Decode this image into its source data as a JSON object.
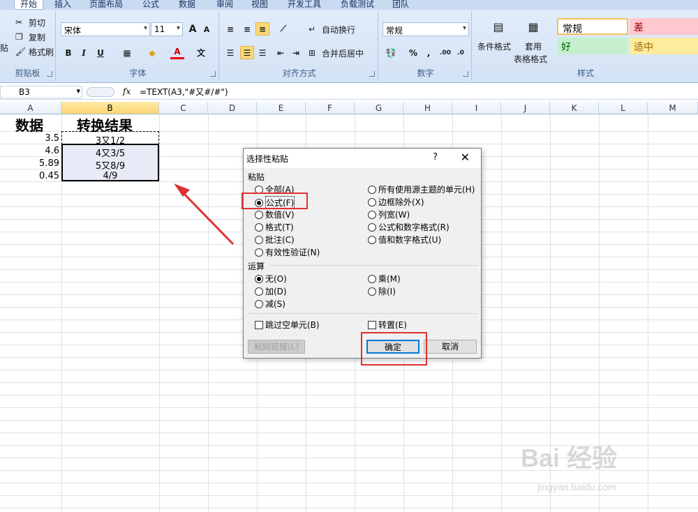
{
  "ribbon": {
    "tabs": [
      "开始",
      "插入",
      "页面布局",
      "公式",
      "数据",
      "审阅",
      "视图",
      "开发工具",
      "负载测试",
      "团队"
    ],
    "clipboard": {
      "cut": "剪切",
      "copy": "复制",
      "painter": "格式刷",
      "paste_partial": "贴",
      "label": "剪贴板"
    },
    "font": {
      "name": "宋体",
      "size": "11",
      "label": "字体",
      "bold": "B",
      "italic": "I",
      "underline": "U",
      "grow": "A",
      "shrink": "A",
      "color_letter": "A",
      "phonetic": "文"
    },
    "alignment": {
      "wrap": "自动换行",
      "merge": "合并后居中",
      "label": "对齐方式"
    },
    "number": {
      "format": "常规",
      "percent": "%",
      "comma": ",",
      "label": "数字",
      "inc_dec": ".00",
      "dec_dec": ".0"
    },
    "styles": {
      "conditional": "条件格式",
      "table": "套用",
      "table2": "表格格式",
      "normal": "常规",
      "bad": "差",
      "good": "好",
      "neutral": "适中",
      "label": "样式"
    }
  },
  "formula_bar": {
    "name_box": "B3",
    "fx": "fx",
    "formula": "=TEXT(A3,\"#又#/#\")"
  },
  "grid": {
    "columns": [
      "A",
      "B",
      "C",
      "D",
      "E",
      "F",
      "G",
      "H",
      "I",
      "J",
      "K",
      "L",
      "M"
    ],
    "header_a": "数据",
    "header_b": "转换结果",
    "a_values": [
      "3.5",
      "4.6",
      "5.89",
      "0.45"
    ],
    "b_values": [
      "3又1/2",
      "4又3/5",
      "5又8/9",
      "4/9"
    ]
  },
  "dialog": {
    "title": "选择性粘贴",
    "help": "?",
    "close": "✕",
    "paste_label": "粘贴",
    "paste_left": [
      "全部(A)",
      "公式(F)",
      "数值(V)",
      "格式(T)",
      "批注(C)",
      "有效性验证(N)"
    ],
    "paste_right": [
      "所有使用源主题的单元(H)",
      "边框除外(X)",
      "列宽(W)",
      "公式和数字格式(R)",
      "值和数字格式(U)"
    ],
    "op_label": "运算",
    "op_left": [
      "无(O)",
      "加(D)",
      "减(S)"
    ],
    "op_right": [
      "乘(M)",
      "除(I)"
    ],
    "skip_blanks": "跳过空单元(B)",
    "transpose": "转置(E)",
    "paste_link": "粘贴链接(L)",
    "ok": "确定",
    "cancel": "取消"
  },
  "watermark": {
    "brand": "Bai 经验",
    "url": "jingyan.baidu.com"
  },
  "colors": {
    "highlight": "#e03030",
    "selection": "#e8ebf7",
    "bad_bg": "#ffc7ce",
    "good_bg": "#c6efce",
    "neutral_bg": "#ffeb9c"
  }
}
